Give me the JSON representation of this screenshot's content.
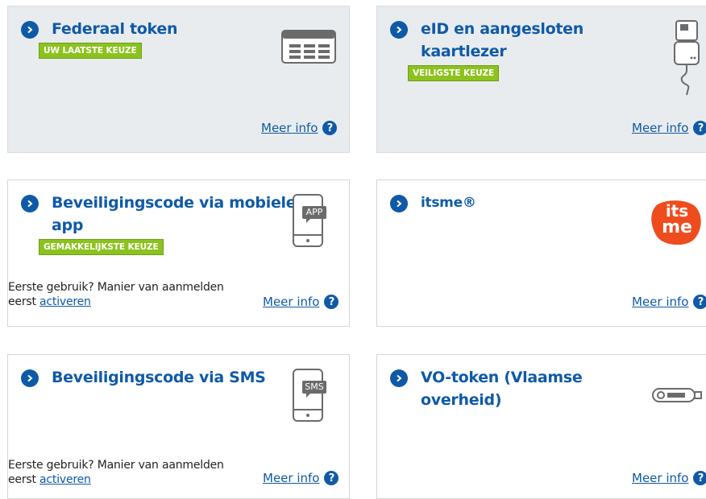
{
  "cards": [
    {
      "title": "Federaal token",
      "badge": "UW LAATSTE KEUZE",
      "meer_info": "Meer info",
      "help": "?"
    },
    {
      "title_line1": "eID en aangesloten",
      "title_line2": "kaartlezer",
      "badge": "VEILIGSTE KEUZE",
      "meer_info": "Meer info",
      "help": "?"
    },
    {
      "title_line1": "Beveiligingscode via mobiele",
      "title_line2": "app",
      "badge": "GEMAKKELIJKSTE KEUZE",
      "icon_label": "APP",
      "first_use_text": "Eerste gebruik? Manier van aanmelden",
      "first_use_prefix": "eerst",
      "first_use_link": "activeren",
      "meer_info": "Meer info",
      "help": "?"
    },
    {
      "title": "itsme®",
      "logo_line1": "its",
      "logo_line2": "me",
      "meer_info": "Meer info",
      "help": "?"
    },
    {
      "title": "Beveiligingscode via SMS",
      "icon_label": "SMS",
      "first_use_text": "Eerste gebruik? Manier van aanmelden",
      "first_use_prefix": "eerst",
      "first_use_link": "activeren",
      "meer_info": "Meer info",
      "help": "?"
    },
    {
      "title_line1": "VO-token (Vlaamse",
      "title_line2": "overheid)",
      "meer_info": "Meer info",
      "help": "?"
    }
  ],
  "colors": {
    "brand_blue": "#0f5aa7",
    "badge_green": "#8cc21e",
    "itsme_orange": "#ee4c1e",
    "card_grey": "#e9ecef"
  }
}
